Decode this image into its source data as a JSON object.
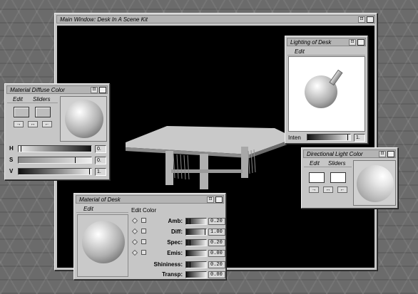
{
  "main_window": {
    "title": "Main Window: Desk In A Scene Kit"
  },
  "lighting_window": {
    "title": "Lighting of Desk",
    "menu": "Edit",
    "intensity_label": "Inten",
    "intensity_value": "1.",
    "intensity": 0.95
  },
  "material_color_window": {
    "title": "Material Diffuse Color",
    "menu_edit": "Edit",
    "menu_sliders": "Sliders",
    "h_label": "H",
    "h_value": "0.",
    "h_level": 0.04,
    "s_label": "S",
    "s_value": "0.",
    "s_level": 0.78,
    "v_label": "V",
    "v_value": "1.",
    "v_level": 0.98
  },
  "directional_light_window": {
    "title": "Directional Light Color",
    "menu_edit": "Edit",
    "menu_sliders": "Sliders"
  },
  "material_desk_window": {
    "title": "Material of Desk",
    "menu_edit": "Edit",
    "edit_color_label": "Edit Color",
    "rows": [
      {
        "label": "Amb:",
        "value": "0.20",
        "level": 0.2
      },
      {
        "label": "Diff:",
        "value": "1.00",
        "level": 0.95
      },
      {
        "label": "Spec:",
        "value": "0.20",
        "level": 0.2
      },
      {
        "label": "Emis:",
        "value": "0.00",
        "level": 0.0
      }
    ],
    "shininess_label": "Shininess:",
    "shininess_value": "0.20",
    "transp_label": "Transp:",
    "transp_value": "0.00"
  },
  "icons": [
    "window-menu-icon",
    "maximize-icon",
    "arrow-right-icon",
    "arrow-both-icon",
    "arrow-left-icon"
  ],
  "colors": {
    "desktop": "#6b6b6b",
    "window": "#c6c6c6",
    "viewport": "#000000"
  }
}
